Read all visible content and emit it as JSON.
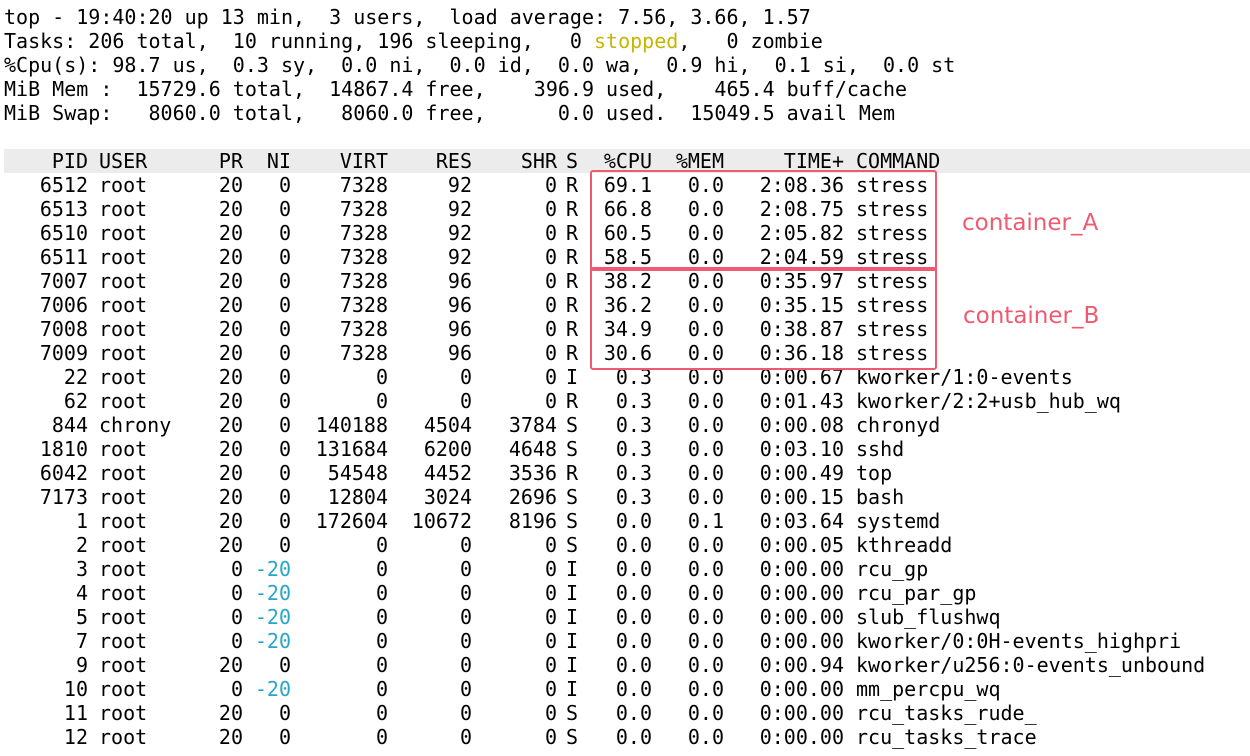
{
  "summary": {
    "line1": "top - 19:40:20 up 13 min,  3 users,  load average: 7.56, 3.66, 1.57",
    "tasks_pre": "Tasks: 206 total,  10 running, 196 sleeping,   0 ",
    "tasks_stopped": "stopped",
    "tasks_post": ",   0 zombie",
    "cpu": "%Cpu(s): 98.7 us,  0.3 sy,  0.0 ni,  0.0 id,  0.0 wa,  0.9 hi,  0.1 si,  0.0 st",
    "mem": "MiB Mem :  15729.6 total,  14867.4 free,    396.9 used,    465.4 buff/cache",
    "swap": "MiB Swap:   8060.0 total,   8060.0 free,      0.0 used.  15049.5 avail Mem"
  },
  "columns": [
    "PID",
    "USER",
    "PR",
    "NI",
    "VIRT",
    "RES",
    "SHR",
    "S",
    "%CPU",
    "%MEM",
    "TIME+",
    "COMMAND"
  ],
  "processes": [
    [
      "6512",
      "root",
      "20",
      "0",
      "7328",
      "92",
      "0",
      "R",
      "69.1",
      "0.0",
      "2:08.36",
      "stress"
    ],
    [
      "6513",
      "root",
      "20",
      "0",
      "7328",
      "92",
      "0",
      "R",
      "66.8",
      "0.0",
      "2:08.75",
      "stress"
    ],
    [
      "6510",
      "root",
      "20",
      "0",
      "7328",
      "92",
      "0",
      "R",
      "60.5",
      "0.0",
      "2:05.82",
      "stress"
    ],
    [
      "6511",
      "root",
      "20",
      "0",
      "7328",
      "92",
      "0",
      "R",
      "58.5",
      "0.0",
      "2:04.59",
      "stress"
    ],
    [
      "7007",
      "root",
      "20",
      "0",
      "7328",
      "96",
      "0",
      "R",
      "38.2",
      "0.0",
      "0:35.97",
      "stress"
    ],
    [
      "7006",
      "root",
      "20",
      "0",
      "7328",
      "96",
      "0",
      "R",
      "36.2",
      "0.0",
      "0:35.15",
      "stress"
    ],
    [
      "7008",
      "root",
      "20",
      "0",
      "7328",
      "96",
      "0",
      "R",
      "34.9",
      "0.0",
      "0:38.87",
      "stress"
    ],
    [
      "7009",
      "root",
      "20",
      "0",
      "7328",
      "96",
      "0",
      "R",
      "30.6",
      "0.0",
      "0:36.18",
      "stress"
    ],
    [
      "22",
      "root",
      "20",
      "0",
      "0",
      "0",
      "0",
      "I",
      "0.3",
      "0.0",
      "0:00.67",
      "kworker/1:0-events"
    ],
    [
      "62",
      "root",
      "20",
      "0",
      "0",
      "0",
      "0",
      "R",
      "0.3",
      "0.0",
      "0:01.43",
      "kworker/2:2+usb_hub_wq"
    ],
    [
      "844",
      "chrony",
      "20",
      "0",
      "140188",
      "4504",
      "3784",
      "S",
      "0.3",
      "0.0",
      "0:00.08",
      "chronyd"
    ],
    [
      "1810",
      "root",
      "20",
      "0",
      "131684",
      "6200",
      "4648",
      "S",
      "0.3",
      "0.0",
      "0:03.10",
      "sshd"
    ],
    [
      "6042",
      "root",
      "20",
      "0",
      "54548",
      "4452",
      "3536",
      "R",
      "0.3",
      "0.0",
      "0:00.49",
      "top"
    ],
    [
      "7173",
      "root",
      "20",
      "0",
      "12804",
      "3024",
      "2696",
      "S",
      "0.3",
      "0.0",
      "0:00.15",
      "bash"
    ],
    [
      "1",
      "root",
      "20",
      "0",
      "172604",
      "10672",
      "8196",
      "S",
      "0.0",
      "0.1",
      "0:03.64",
      "systemd"
    ],
    [
      "2",
      "root",
      "20",
      "0",
      "0",
      "0",
      "0",
      "S",
      "0.0",
      "0.0",
      "0:00.05",
      "kthreadd"
    ],
    [
      "3",
      "root",
      "0",
      "-20",
      "0",
      "0",
      "0",
      "I",
      "0.0",
      "0.0",
      "0:00.00",
      "rcu_gp"
    ],
    [
      "4",
      "root",
      "0",
      "-20",
      "0",
      "0",
      "0",
      "I",
      "0.0",
      "0.0",
      "0:00.00",
      "rcu_par_gp"
    ],
    [
      "5",
      "root",
      "0",
      "-20",
      "0",
      "0",
      "0",
      "I",
      "0.0",
      "0.0",
      "0:00.00",
      "slub_flushwq"
    ],
    [
      "7",
      "root",
      "0",
      "-20",
      "0",
      "0",
      "0",
      "I",
      "0.0",
      "0.0",
      "0:00.00",
      "kworker/0:0H-events_highpri"
    ],
    [
      "9",
      "root",
      "20",
      "0",
      "0",
      "0",
      "0",
      "I",
      "0.0",
      "0.0",
      "0:00.94",
      "kworker/u256:0-events_unbound"
    ],
    [
      "10",
      "root",
      "0",
      "-20",
      "0",
      "0",
      "0",
      "I",
      "0.0",
      "0.0",
      "0:00.00",
      "mm_percpu_wq"
    ],
    [
      "11",
      "root",
      "20",
      "0",
      "0",
      "0",
      "0",
      "S",
      "0.0",
      "0.0",
      "0:00.00",
      "rcu_tasks_rude_"
    ],
    [
      "12",
      "root",
      "20",
      "0",
      "0",
      "0",
      "0",
      "S",
      "0.0",
      "0.0",
      "0:00.00",
      "rcu_tasks_trace"
    ]
  ],
  "annotations": {
    "container_a": "container_A",
    "container_b": "container_B",
    "color": "#ef5a70"
  },
  "colors": {
    "stopped": "#c7b500",
    "negative_nice": "#26a5c9",
    "header_bar": "#ececec"
  }
}
